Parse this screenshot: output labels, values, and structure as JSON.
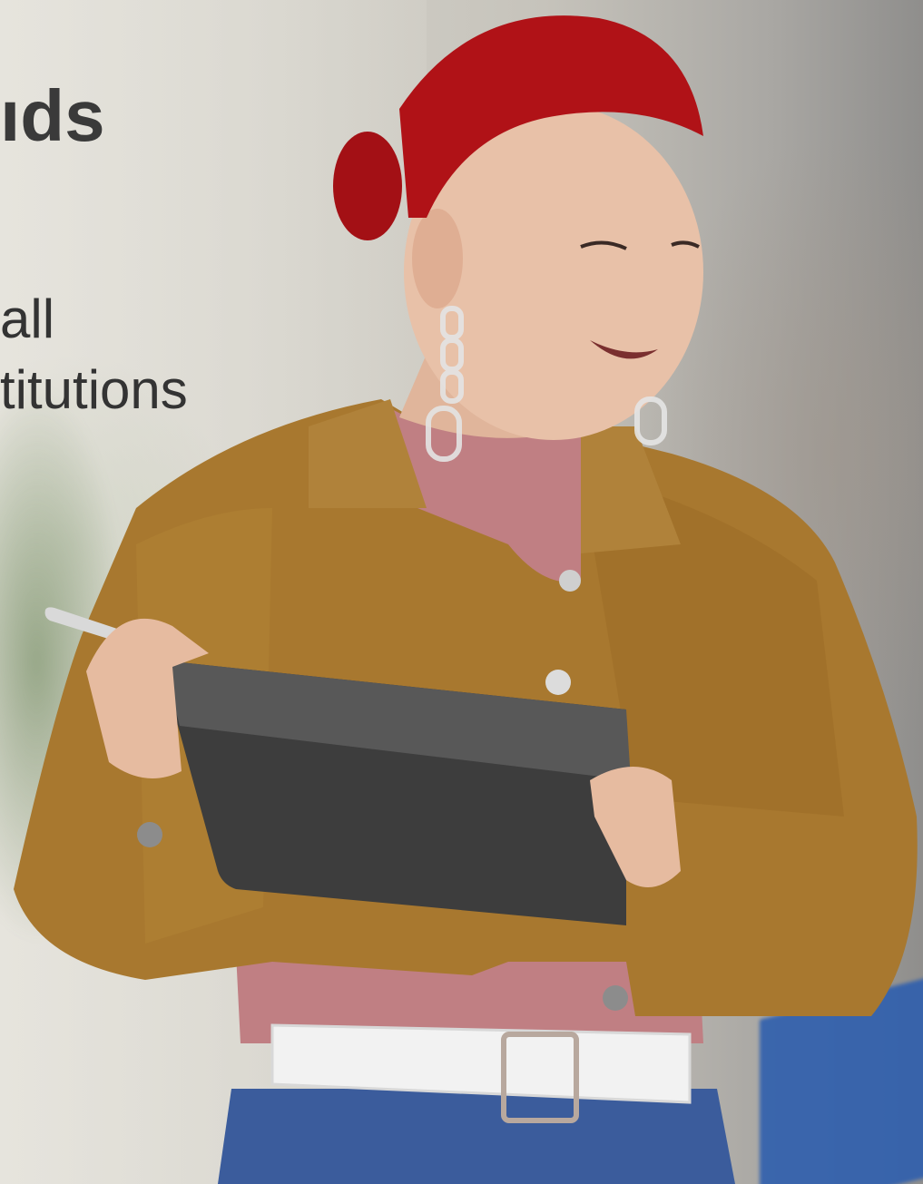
{
  "hero": {
    "headline": "ıds",
    "subtext_lines": [
      "all",
      "titutions"
    ]
  },
  "photo": {
    "subject": "woman-with-tablet-photo",
    "colors": {
      "hair": "#b01217",
      "jacket": "#a8782f",
      "sweater": "#c07f83",
      "tablet": "#3d3d3d",
      "belt": "#f2f2f2",
      "skirt": "#3b5c9c",
      "skin": "#e8c1a8"
    }
  }
}
